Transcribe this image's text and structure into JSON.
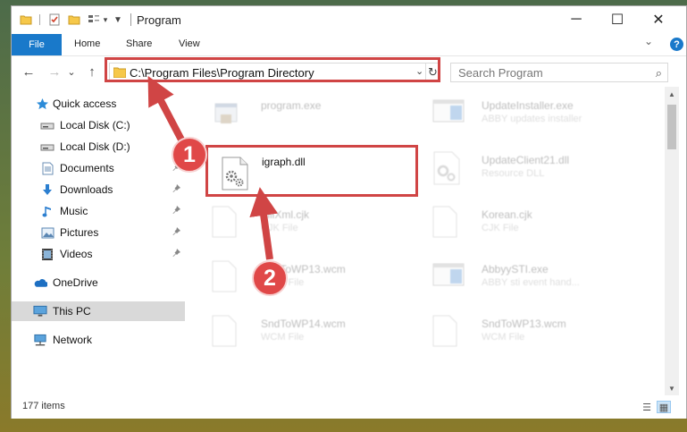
{
  "titlebar": {
    "title": "Program",
    "quick_access_icons": [
      "folder-icon",
      "properties-icon",
      "new-folder-icon",
      "view-options-icon",
      "customize-dropdown-icon"
    ],
    "minimize": "─",
    "maximize": "☐",
    "close": "✕"
  },
  "ribbon": {
    "tabs": [
      "File",
      "Home",
      "Share",
      "View"
    ],
    "expand": "⌄",
    "help": "?"
  },
  "navbar": {
    "back": "←",
    "forward": "→",
    "recent": "⌄",
    "up": "↑",
    "address": "C:\\Program Files\\Program Directory",
    "address_dropdown": "⌄",
    "refresh": "↻",
    "search_placeholder": "Search Program",
    "search_icon": "⌕"
  },
  "sidebar": {
    "items": [
      {
        "label": "Quick access",
        "icon": "star-icon",
        "pinned": false
      },
      {
        "label": "Local Disk (C:)",
        "icon": "drive-icon",
        "pinned": false
      },
      {
        "label": "Local Disk (D:)",
        "icon": "drive-icon",
        "pinned": false
      },
      {
        "label": "Documents",
        "icon": "documents-icon",
        "pinned": true
      },
      {
        "label": "Downloads",
        "icon": "downloads-icon",
        "pinned": true
      },
      {
        "label": "Music",
        "icon": "music-icon",
        "pinned": true
      },
      {
        "label": "Pictures",
        "icon": "pictures-icon",
        "pinned": true
      },
      {
        "label": "Videos",
        "icon": "videos-icon",
        "pinned": true
      },
      {
        "label": "OneDrive",
        "icon": "cloud-icon",
        "pinned": false
      },
      {
        "label": "This PC",
        "icon": "computer-icon",
        "pinned": false,
        "selected": true
      },
      {
        "label": "Network",
        "icon": "network-icon",
        "pinned": false
      }
    ],
    "pin_glyph": "📌"
  },
  "files": [
    {
      "name": "program.exe",
      "type": "",
      "icon": "exe-icon",
      "faded": true
    },
    {
      "name": "UpdateInstaller.exe",
      "type": "ABBY updates installer",
      "icon": "window-app-icon",
      "faded": true
    },
    {
      "name": "igraph.dll",
      "type": "",
      "icon": "dll-gears-icon",
      "faded": false
    },
    {
      "name": "UpdateClient21.dll",
      "type": "Resource DLL",
      "icon": "dll-gears-icon",
      "faded": true
    },
    {
      "name": "FillXml.cjk",
      "type": "CJK File",
      "icon": "blank-file-icon",
      "faded": true
    },
    {
      "name": "Korean.cjk",
      "type": "CJK File",
      "icon": "blank-file-icon",
      "faded": true
    },
    {
      "name": "SndToWP13.wcm",
      "type": "WCM File",
      "icon": "blank-file-icon",
      "faded": true
    },
    {
      "name": "AbbyySTI.exe",
      "type": "ABBY sti event hand...",
      "icon": "window-app-icon",
      "faded": true
    },
    {
      "name": "SndToWP14.wcm",
      "type": "WCM File",
      "icon": "blank-file-icon",
      "faded": true
    },
    {
      "name": "SndToWP13.wcm",
      "type": "WCM File",
      "icon": "blank-file-icon",
      "faded": true
    }
  ],
  "status": {
    "item_count": "177 items",
    "details_view_icon": "☰",
    "large_icons_view_icon": "▦"
  },
  "annotations": {
    "callout_1": "1",
    "callout_2": "2",
    "color": "#d04545"
  },
  "scrollbar": {
    "up": "▲",
    "down": "▼"
  }
}
